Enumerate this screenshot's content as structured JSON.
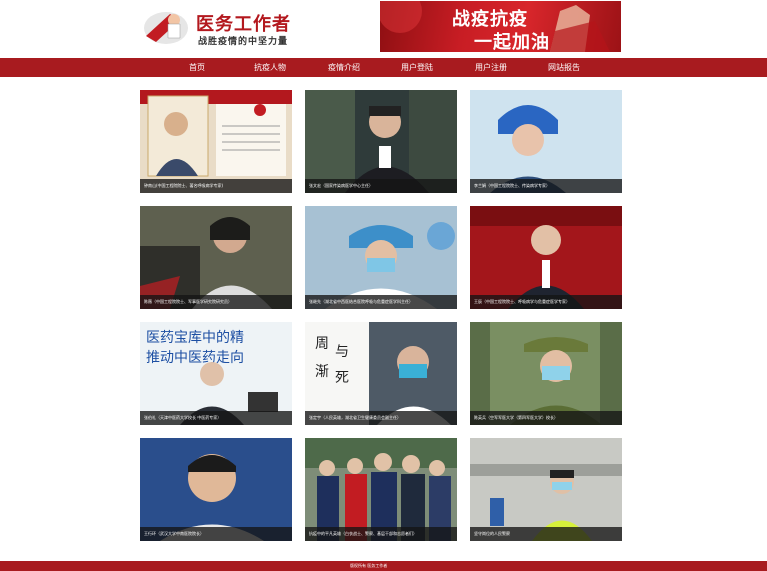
{
  "header": {
    "logo_title": "医务工作者",
    "logo_subtitle": "战胜疫情的中坚力量"
  },
  "banner": {
    "line1": "战疫抗疫",
    "line2": "一起加油"
  },
  "nav": {
    "items": [
      {
        "label": "首页"
      },
      {
        "label": "抗疫人物"
      },
      {
        "label": "疫情介绍"
      },
      {
        "label": "用户登陆"
      },
      {
        "label": "用户注册"
      },
      {
        "label": "网站报告"
      }
    ]
  },
  "cards": [
    {
      "caption": "钟南山(中国工程院院士、著名呼吸病学专家)",
      "bg": "#d2b89a"
    },
    {
      "caption": "张文宏（国家传染病医学中心主任）",
      "bg": "#3f3f3f"
    },
    {
      "caption": "李兰娟（中国工程院院士、传染病学专家）",
      "bg": "#8fb6d6"
    },
    {
      "caption": "陈薇（中国工程院院士、军事医学研究院研究员）",
      "bg": "#6e6e6a"
    },
    {
      "caption": "张继先（湖北省中西医结合医院呼吸与危重症医学科主任）",
      "bg": "#6f8ea8"
    },
    {
      "caption": "王辰（中国工程院院士、呼吸病学与危重症医学专家）",
      "bg": "#8a1216"
    },
    {
      "caption": "张伯礼（天津中医药大学校长 中医药专家）",
      "bg": "#e8eef2"
    },
    {
      "caption": "张定宇（人民英雄，湖北省卫生健康委员会副主任）",
      "bg": "#3b3f44"
    },
    {
      "caption": "陈英兵（空军军医大学（第四军医大学）校长）",
      "bg": "#5e6f54"
    },
    {
      "caption": "王行环（武汉大学中南医院院长）",
      "bg": "#2a4e8c"
    },
    {
      "caption": "抗疫中的平凡英雄（白衣战士、警察、基层干部和志愿者们）",
      "bg": "#475c46"
    },
    {
      "caption": "坚守岗位的人民警察",
      "bg": "#b9b9b3"
    }
  ],
  "footer": {
    "text": "版权所有 医务工作者"
  }
}
